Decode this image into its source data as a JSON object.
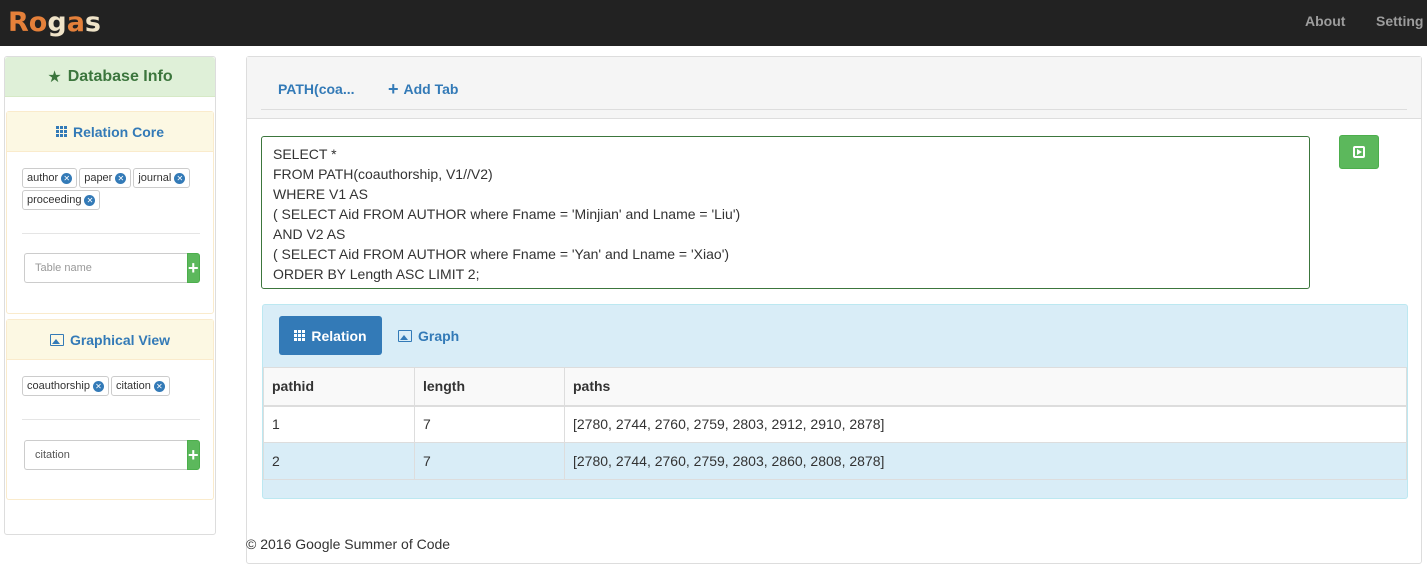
{
  "app": {
    "logo_text": [
      "R",
      "o",
      "g",
      "a",
      "s"
    ],
    "nav": {
      "about": "About",
      "setting": "Setting"
    }
  },
  "sidebar": {
    "title": "Database Info",
    "title_icon": "star-icon",
    "relation_core": {
      "title": "Relation Core",
      "tags": [
        "author",
        "paper",
        "journal",
        "proceeding"
      ],
      "input_placeholder": "Table name",
      "add_label": "+"
    },
    "graphical_view": {
      "title": "Graphical View",
      "tags": [
        "coauthorship",
        "citation"
      ],
      "input_value": "citation",
      "add_label": "+"
    }
  },
  "main": {
    "tabs": [
      {
        "label": "PATH(coa...",
        "active": true
      },
      {
        "label": "Add Tab",
        "icon": "plus-icon"
      }
    ],
    "query_lines": [
      "SELECT *",
      "FROM PATH(coauthorship, V1//V2)",
      "WHERE V1 AS",
      "( SELECT Aid FROM AUTHOR where Fname = 'Minjian' and Lname = 'Liu')",
      "AND V2 AS",
      "( SELECT Aid FROM AUTHOR where Fname = 'Yan' and Lname = 'Xiao')",
      "ORDER BY Length ASC LIMIT 2;"
    ],
    "result_tabs": {
      "relation": "Relation",
      "graph": "Graph"
    },
    "table": {
      "columns": [
        "pathid",
        "length",
        "paths"
      ],
      "rows": [
        [
          "1",
          "7",
          "[2780, 2744, 2760, 2759, 2803, 2912, 2910, 2878]"
        ],
        [
          "2",
          "7",
          "[2780, 2744, 2760, 2759, 2803, 2860, 2808, 2878]"
        ]
      ]
    }
  },
  "footer": "© 2016 Google Summer of Code",
  "colors": {
    "navbar": "#222222",
    "accent_blue": "#337ab7",
    "success_green": "#5cb85c",
    "info_bg": "#d9edf7",
    "logo_orange": "#e4803a"
  }
}
